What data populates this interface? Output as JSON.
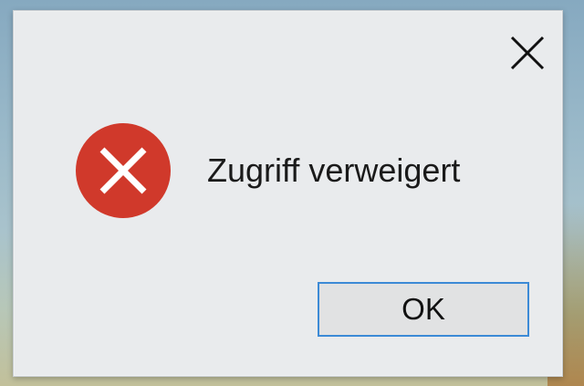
{
  "dialog": {
    "message": "Zugriff verweigert",
    "ok_label": "OK",
    "icons": {
      "status": "error-icon",
      "close": "close-icon"
    },
    "colors": {
      "error": "#d0392b",
      "button_focus_border": "#3c8ad6",
      "dialog_bg": "#e9ebed"
    }
  }
}
